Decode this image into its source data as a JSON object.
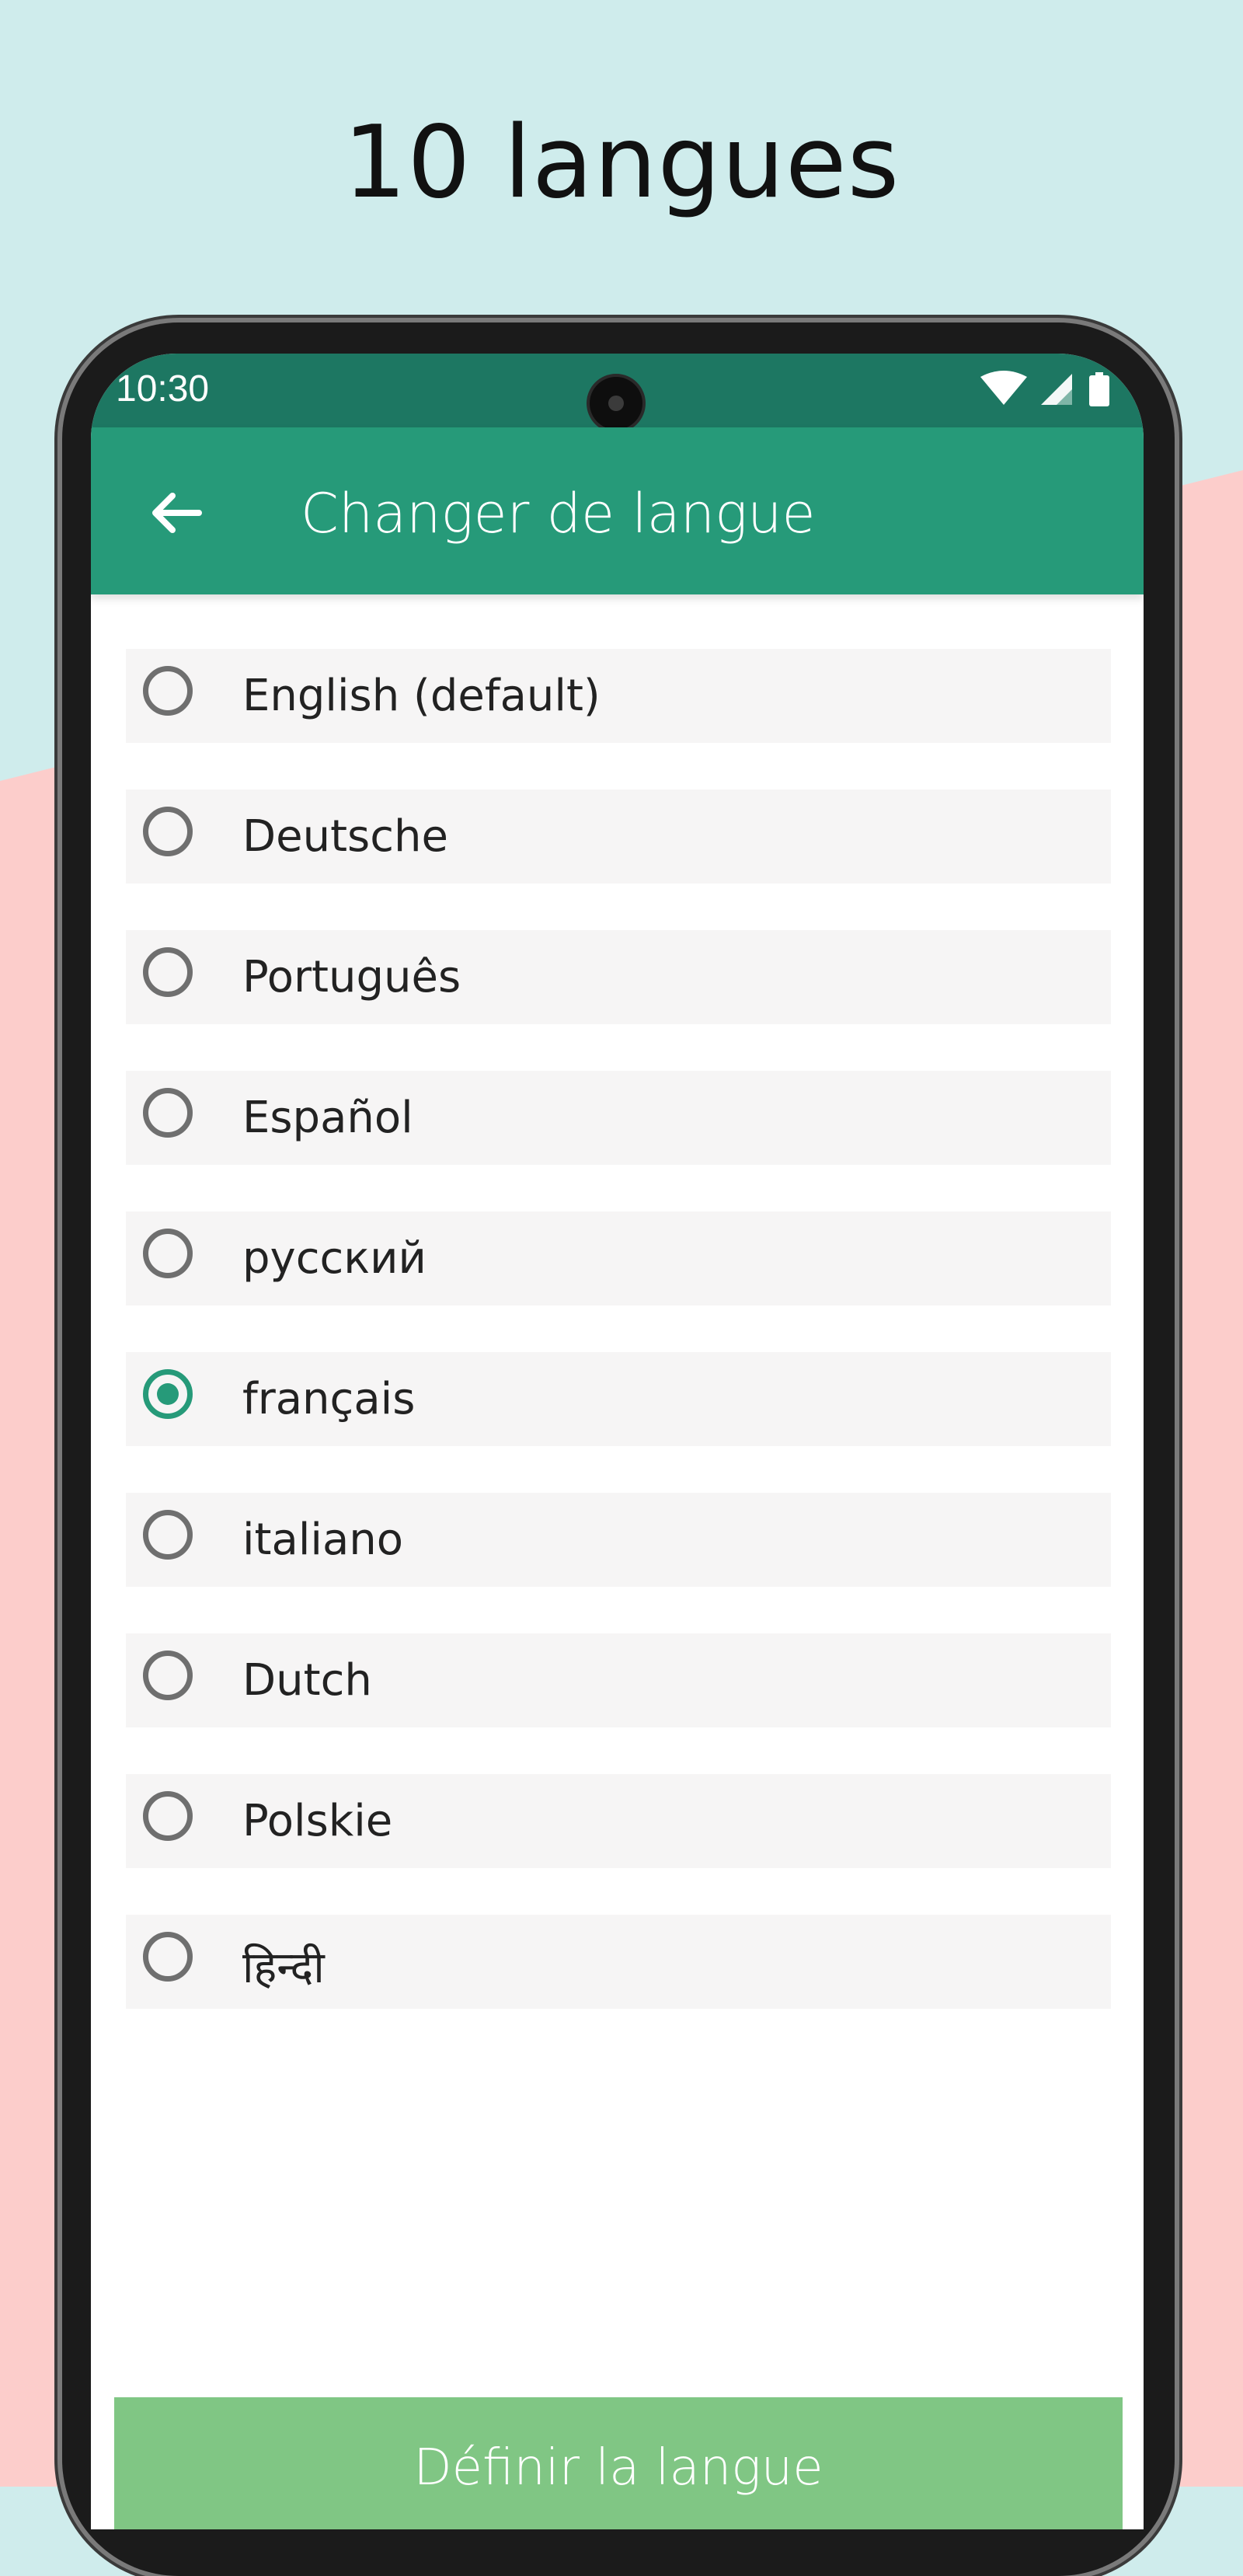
{
  "headline": "10 langues",
  "status_bar": {
    "time": "10:30",
    "icons": [
      "wifi-icon",
      "signal-icon",
      "battery-icon"
    ]
  },
  "app_bar": {
    "back_icon": "arrow-left-icon",
    "title": "Changer de langue"
  },
  "languages": [
    {
      "label": "English (default)",
      "selected": false
    },
    {
      "label": "Deutsche",
      "selected": false
    },
    {
      "label": "Português",
      "selected": false
    },
    {
      "label": "Español",
      "selected": false
    },
    {
      "label": "русский",
      "selected": false
    },
    {
      "label": "français",
      "selected": true
    },
    {
      "label": "italiano",
      "selected": false
    },
    {
      "label": "Dutch",
      "selected": false
    },
    {
      "label": "Polskie",
      "selected": false
    },
    {
      "label": "हिन्दी",
      "selected": false
    }
  ],
  "set_button_label": "Définir la langue",
  "colors": {
    "accent": "#269a79",
    "status_bar": "#1d7762",
    "button": "#80c684",
    "bg_top": "#cfecec",
    "bg_bottom": "#fccdcb"
  }
}
